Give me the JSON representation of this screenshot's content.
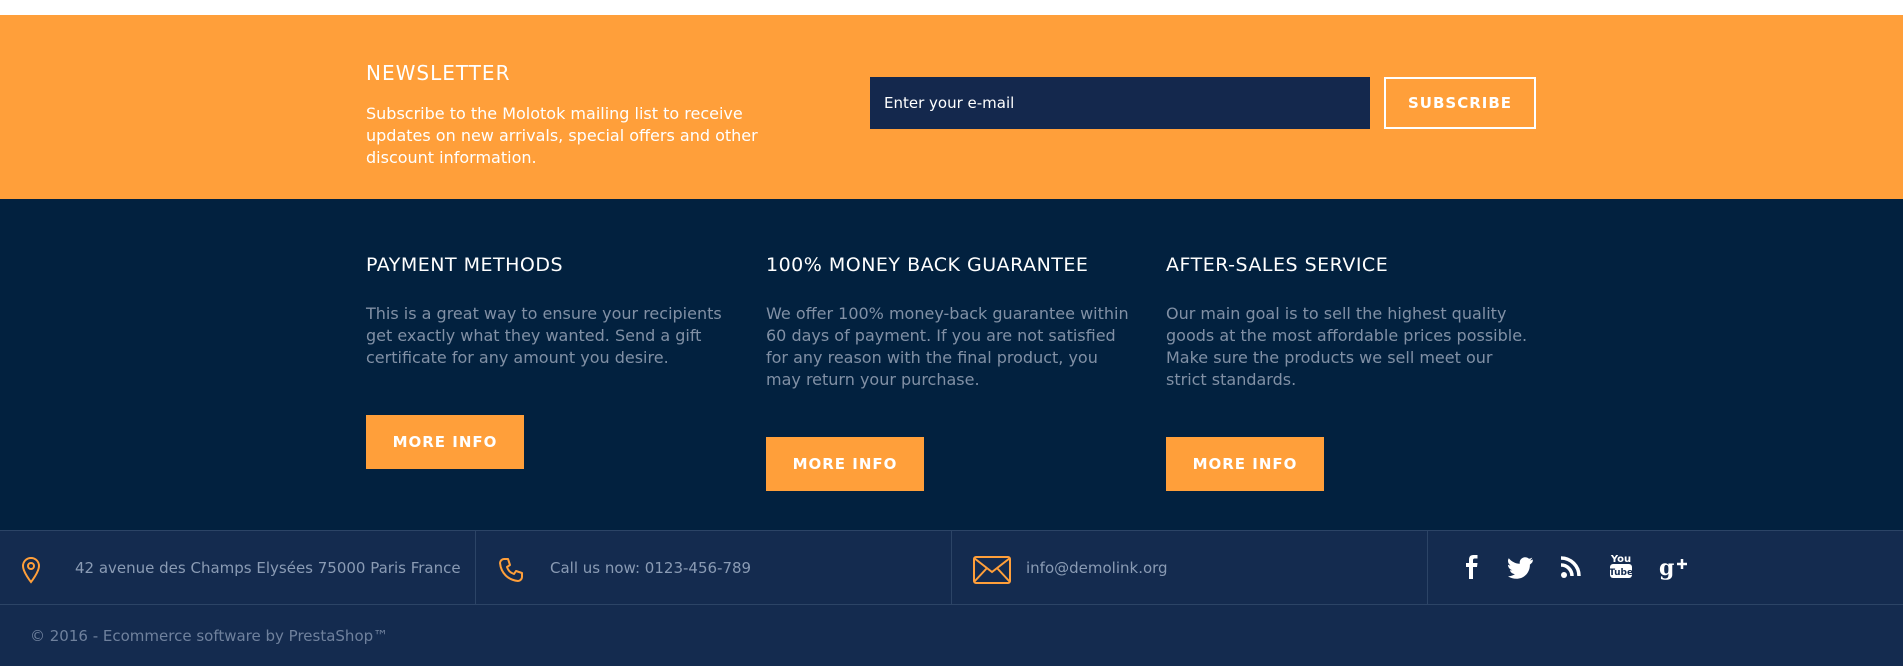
{
  "colors": {
    "accent": "#ff9f3a",
    "navy": "#02213f",
    "navy_light": "#142b4f"
  },
  "newsletter": {
    "title": "NEWSLETTER",
    "description": "Subscribe to the Molotok mailing list to receive updates on new arrivals, special offers and other discount information.",
    "placeholder": "Enter your e-mail",
    "button": "SUBSCRIBE"
  },
  "features": [
    {
      "title": "PAYMENT METHODS",
      "text": "This is a great way to ensure your recipients get exactly what they wanted. Send a gift certificate for any amount you desire.",
      "button": "MORE INFO"
    },
    {
      "title": "100% MONEY BACK GUARANTEE",
      "text": "We offer 100% money-back guarantee within 60 days of payment. If you are not satisfied for any reason with the final product, you may return your purchase.",
      "button": "MORE INFO"
    },
    {
      "title": "AFTER-SALES SERVICE",
      "text": "Our main goal is to sell the highest quality goods at the most affordable prices possible. Make sure the products we sell meet our strict standards.",
      "button": "MORE INFO"
    }
  ],
  "contact": {
    "address": "42 avenue des Champs Elysées 75000 Paris France",
    "phone": "Call us now: 0123-456-789",
    "email": "info@demolink.org",
    "icons": [
      "location-pin-icon",
      "phone-icon",
      "envelope-icon"
    ]
  },
  "social": [
    "facebook-icon",
    "twitter-icon",
    "rss-icon",
    "youtube-icon",
    "google-plus-icon"
  ],
  "copyright": "© 2016 - Ecommerce software by PrestaShop™"
}
